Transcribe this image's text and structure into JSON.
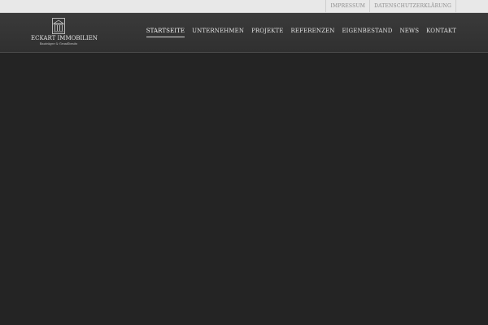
{
  "topbar": {
    "links": [
      "IMPRESSUM",
      "DATENSCHUTZERKLÄRUNG"
    ]
  },
  "logo": {
    "name": "ECKART IMMOBILIEN",
    "tagline": "Bauträger & Grundbesitz",
    "icon": "building-columns-icon"
  },
  "nav": {
    "items": [
      "STARTSEITE",
      "UNTERNEHMEN",
      "PROJEKTE",
      "REFERENZEN",
      "EIGENBESTAND",
      "NEWS",
      "KONTAKT"
    ],
    "active_index": 0
  },
  "colors": {
    "topbar_bg": "#e8e8e8",
    "header_bg": "#333333",
    "page_bg": "#242424",
    "nav_text": "#e0e0e0"
  }
}
